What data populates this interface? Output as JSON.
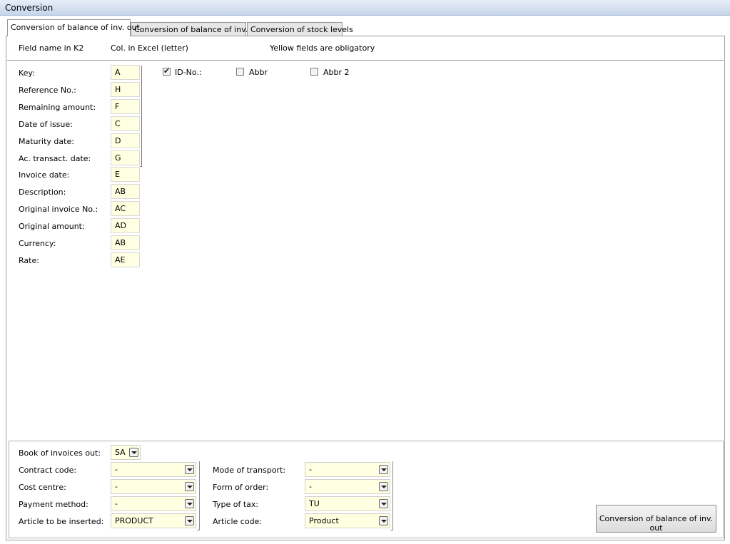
{
  "window": {
    "title": "Conversion"
  },
  "tabs": [
    {
      "label": "Conversion of balance of inv. out"
    },
    {
      "label": "Conversion of balance of inv. in"
    },
    {
      "label": "Conversion of stock levels"
    }
  ],
  "header": {
    "field_name": "Field name in K2",
    "col_excel": "Col. in Excel (letter)",
    "note": "Yellow fields are obligatory"
  },
  "fields": [
    {
      "label": "Key:",
      "value": "A"
    },
    {
      "label": "Reference No.:",
      "value": "H"
    },
    {
      "label": "Remaining amount:",
      "value": "F"
    },
    {
      "label": "Date of issue:",
      "value": "C"
    },
    {
      "label": "Maturity date:",
      "value": "D"
    },
    {
      "label": "Ac. transact. date:",
      "value": "G"
    },
    {
      "label": "Invoice date:",
      "value": "E"
    },
    {
      "label": "Description:",
      "value": "AB"
    },
    {
      "label": "Original invoice No.:",
      "value": "AC"
    },
    {
      "label": "Original amount:",
      "value": "AD"
    },
    {
      "label": "Currency:",
      "value": "AB"
    },
    {
      "label": "Rate:",
      "value": "AE"
    }
  ],
  "checkboxes": [
    {
      "label": "ID-No.:",
      "checked": true
    },
    {
      "label": "Abbr",
      "checked": false
    },
    {
      "label": "Abbr 2",
      "checked": false
    }
  ],
  "bottom": {
    "book": {
      "label": "Book of invoices out:",
      "value": "SA"
    },
    "left": [
      {
        "label": "Contract code:",
        "value": "-"
      },
      {
        "label": "Cost centre:",
        "value": "-"
      },
      {
        "label": "Payment method:",
        "value": "-"
      },
      {
        "label": "Article to be inserted:",
        "value": "PRODUCT"
      }
    ],
    "right": [
      {
        "label": "Mode of transport:",
        "value": "-"
      },
      {
        "label": "Form of order:",
        "value": "-"
      },
      {
        "label": "Type of tax:",
        "value": "TU"
      },
      {
        "label": "Article code:",
        "value": "Product"
      }
    ]
  },
  "action_button": {
    "label": "Conversion of balance of inv. out"
  },
  "colors": {
    "required_field": "#ffffe1",
    "title_bar": "#c6d5ea"
  }
}
